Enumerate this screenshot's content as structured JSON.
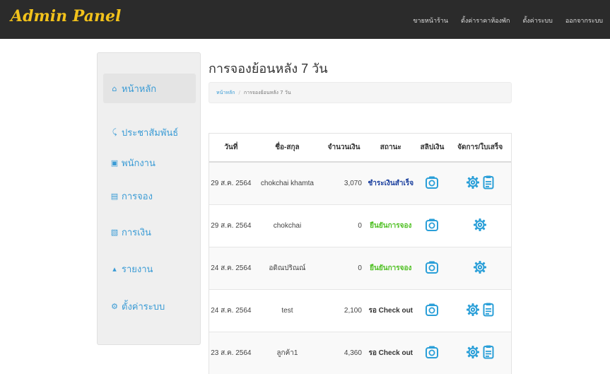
{
  "navbar": {
    "brand": "Admin Panel",
    "links": [
      "ขายหน้าร้าน",
      "ตั้งค่าราคาห้องพัก",
      "ตั้งค่าระบบ",
      "ออกจากระบบ"
    ]
  },
  "sidebar": {
    "items": [
      {
        "label": "หน้าหลัก",
        "icon": "home-icon",
        "active": true
      },
      {
        "label": "ประชาสัมพันธ์",
        "icon": "rss-icon"
      },
      {
        "label": "พนักงาน",
        "icon": "id-card-icon"
      },
      {
        "label": "การจอง",
        "icon": "book-icon"
      },
      {
        "label": "การเงิน",
        "icon": "money-icon"
      },
      {
        "label": "รายงาน",
        "icon": "report-icon"
      },
      {
        "label": "ตั้งค่าระบบ",
        "icon": "gear-icon"
      }
    ]
  },
  "page": {
    "title": "การจองย้อนหลัง 7 วัน",
    "breadcrumb": [
      "หน้าหลัก",
      "การจองย้อนหลัง 7 วัน"
    ]
  },
  "table": {
    "headers": [
      "วันที่",
      "ชื่อ-สกุล",
      "จำนวนเงิน",
      "สถานะ",
      "สลิปเงิน",
      "จัดการ/ใบเสร็จ"
    ],
    "rows": [
      {
        "date": "29 ส.ค. 2564",
        "name": "chokchai khamta",
        "amount": "3,070",
        "status": "ชำระเงินสำเร็จ",
        "status_color": "#1a3f9e",
        "receipt": true
      },
      {
        "date": "29 ส.ค. 2564",
        "name": "chokchai",
        "amount": "0",
        "status": "ยืนยันการจอง",
        "status_color": "#4cbf1f",
        "receipt": false
      },
      {
        "date": "24 ส.ค. 2564",
        "name": "อดิณปริณณ์",
        "amount": "0",
        "status": "ยืนยันการจอง",
        "status_color": "#4cbf1f",
        "receipt": false
      },
      {
        "date": "24 ส.ค. 2564",
        "name": "test",
        "amount": "2,100",
        "status": "รอ Check out",
        "status_color": "#333333",
        "receipt": true
      },
      {
        "date": "23 ส.ค. 2564",
        "name": "ลูกค้า1",
        "amount": "4,360",
        "status": "รอ Check out",
        "status_color": "#333333",
        "receipt": true
      }
    ]
  },
  "colors": {
    "accent": "#3a9bd5",
    "brand": "#f2c21b",
    "navbar": "#2b2b2b"
  }
}
